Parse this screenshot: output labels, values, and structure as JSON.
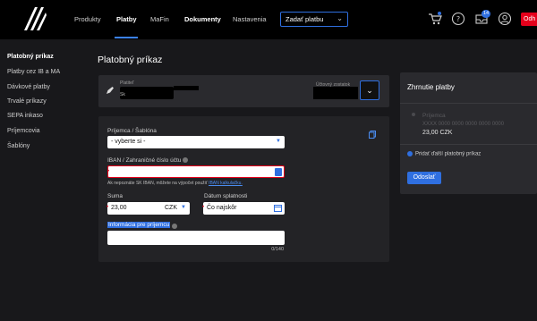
{
  "nav": {
    "items": [
      "Produkty",
      "Platby",
      "MaFin",
      "Dokumenty",
      "Nastavenia"
    ],
    "select_label": "Zadať platbu",
    "messages_badge": "14",
    "logout_label": "Odh"
  },
  "sidebar": {
    "items": [
      "Platobný príkaz",
      "Platby cez IB a MA",
      "Dávkové platby",
      "Trvalé príkazy",
      "SEPA inkaso",
      "Príjemcovia",
      "Šablóny"
    ]
  },
  "page": {
    "title": "Platobný príkaz"
  },
  "payer": {
    "label": "Platiteľ",
    "prefix": "Sk",
    "balance_label": "Účtovný zostatok"
  },
  "form": {
    "recipient_label": "Príjemca / Šablóna",
    "recipient_value": "- vyberte si -",
    "iban_label": "IBAN / Zahraničné číslo účtu",
    "iban_value": "",
    "iban_note": "Ak nepoznáte SK IBAN, môžete na výpočet použiť",
    "iban_link": "IBAN kalkulačku.",
    "amount_label": "Suma",
    "amount_value": "23,00",
    "currency": "CZK",
    "due_label": "Dátum splatnosti",
    "due_value": "Čo najskôr",
    "info_label": "Informácia pre príjemcu",
    "info_value": "",
    "counter": "0/140"
  },
  "summary": {
    "title": "Zhrnutie platby",
    "recipient_name": "Príjemca",
    "account": "XXXX 0000 0000 0000 0000 0000",
    "amount": "23,00 CZK",
    "add_label": "Pridať ďalší platobný príkaz",
    "send_label": "Odoslať"
  },
  "colors": {
    "accent": "#2f6fe0",
    "error": "#e4001b",
    "background": "#18181b",
    "card": "#232326"
  }
}
